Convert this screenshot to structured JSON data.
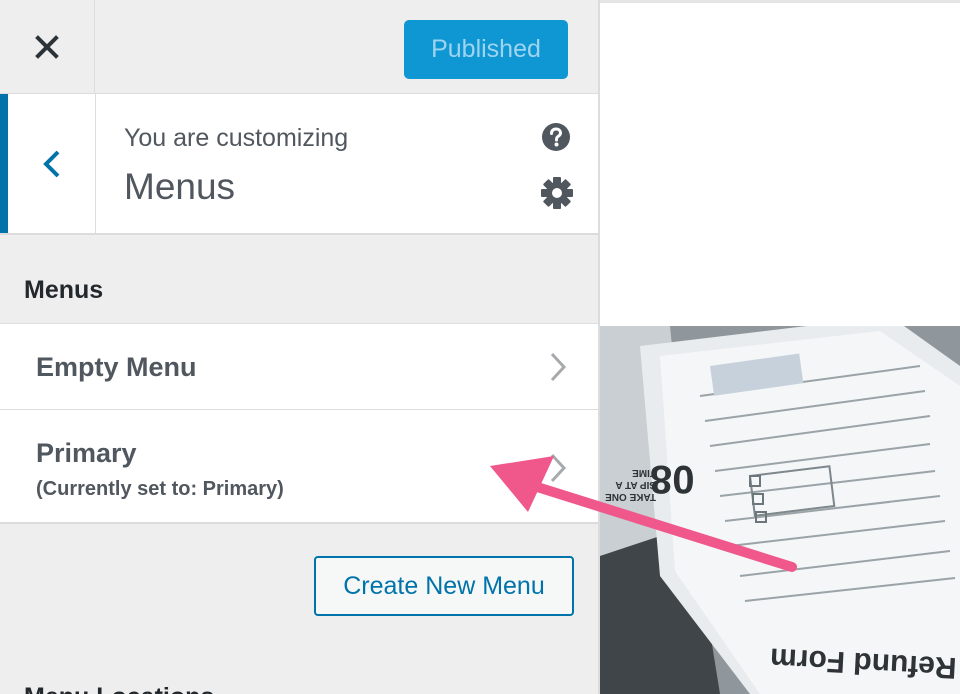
{
  "header": {
    "close_icon": "close-icon",
    "publish_label": "Published"
  },
  "info": {
    "back_icon": "chevron-left-icon",
    "subtitle": "You are customizing",
    "title": "Menus",
    "help_icon": "help-icon",
    "settings_icon": "gear-icon"
  },
  "section": {
    "heading": "Menus"
  },
  "menus": [
    {
      "name": "Empty Menu",
      "note": ""
    },
    {
      "name": "Primary",
      "note": "(Currently set to: Primary)"
    }
  ],
  "create_label": "Create New Menu",
  "locations_heading": "Menu Locations",
  "preview": {
    "form_title": "x Refund Form",
    "stamp_number": "08",
    "stamp_text": "TAKE ONE SIP AT A TIME"
  },
  "colors": {
    "accent": "#0073aa",
    "publish_bg": "#0e97d3",
    "publish_text": "#9fd4f0",
    "annotation_arrow": "#f0588b"
  }
}
